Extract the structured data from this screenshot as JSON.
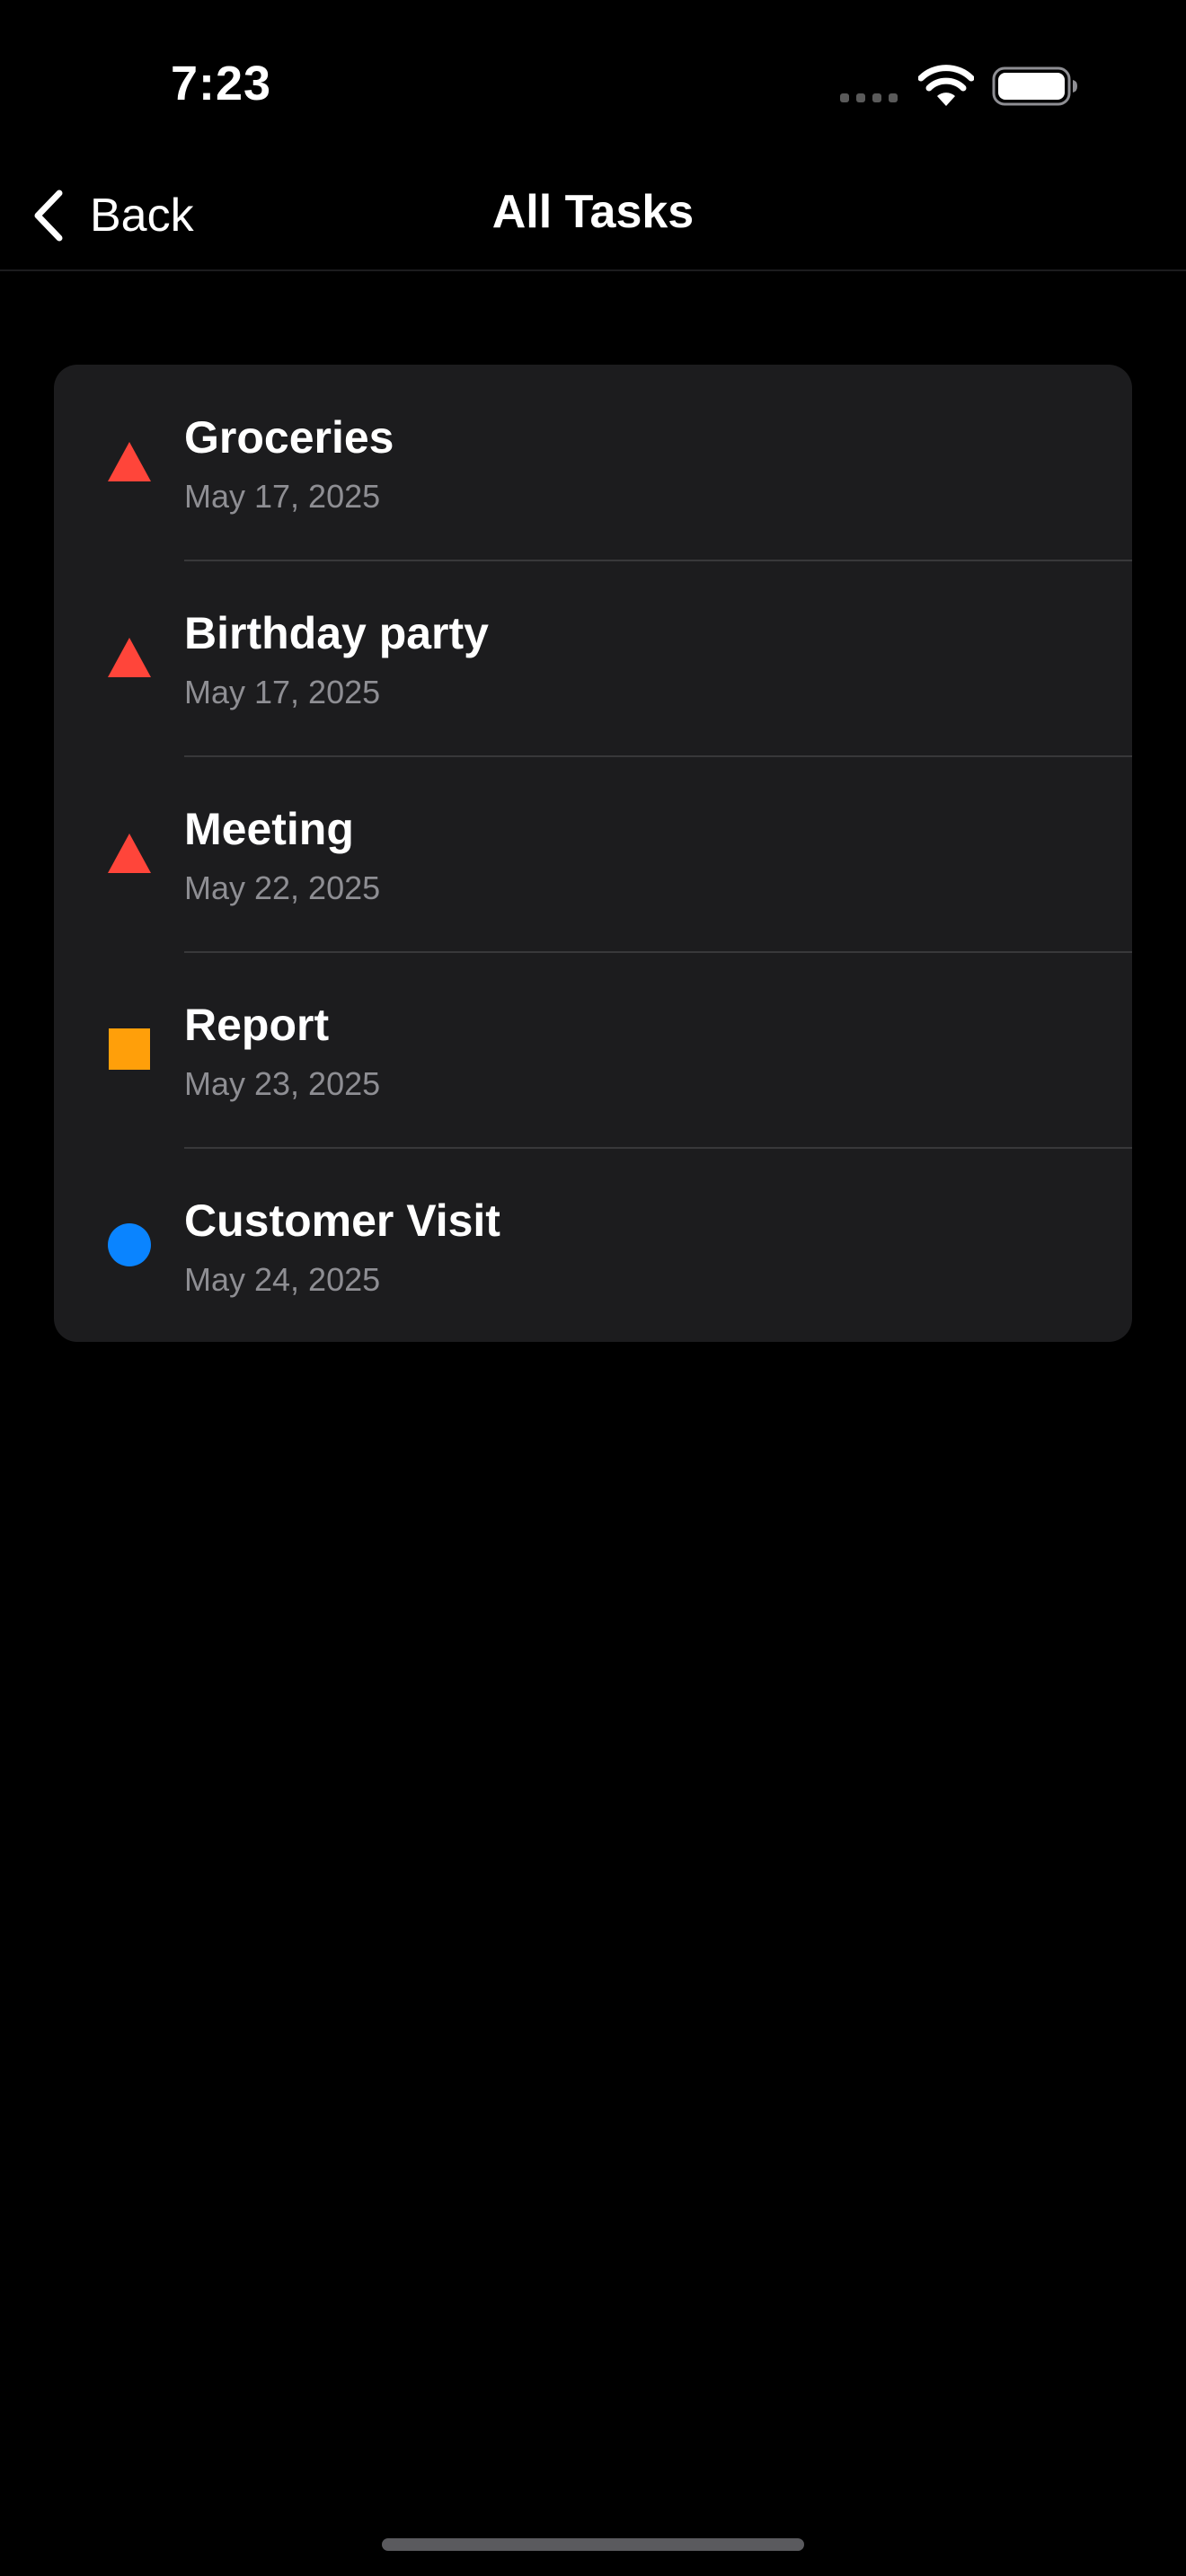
{
  "status_bar": {
    "time": "7:23",
    "icons": [
      "signal-dots-icon",
      "wifi-icon",
      "battery-icon"
    ]
  },
  "nav": {
    "back_label": "Back",
    "title": "All Tasks",
    "back_icon": "chevron-left-icon"
  },
  "colors": {
    "background": "#000000",
    "card": "#1c1c1e",
    "separator": "#38383a",
    "secondary_text": "#8e8e93",
    "priority_high": "#ff453a",
    "priority_medium": "#ff9f0a",
    "priority_low": "#0a84ff"
  },
  "tasks": [
    {
      "title": "Groceries",
      "date": "May 17, 2025",
      "priority_icon": "triangle-icon",
      "color": "#ff453a"
    },
    {
      "title": "Birthday party",
      "date": "May 17, 2025",
      "priority_icon": "triangle-icon",
      "color": "#ff453a"
    },
    {
      "title": "Meeting",
      "date": "May 22, 2025",
      "priority_icon": "triangle-icon",
      "color": "#ff453a"
    },
    {
      "title": "Report",
      "date": "May 23, 2025",
      "priority_icon": "square-icon",
      "color": "#ff9f0a"
    },
    {
      "title": "Customer Visit",
      "date": "May 24, 2025",
      "priority_icon": "circle-icon",
      "color": "#0a84ff"
    }
  ]
}
